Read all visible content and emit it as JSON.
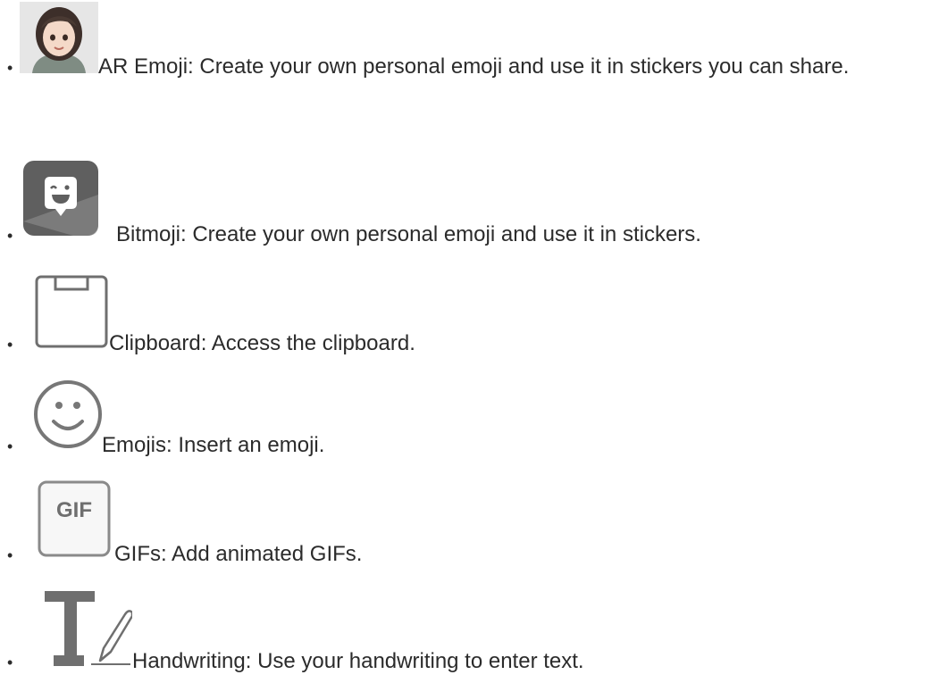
{
  "bullet": "•",
  "features": [
    {
      "icon": "ar-emoji-avatar-icon",
      "text": "AR Emoji: Create your own personal emoji and use it in stickers you can share."
    },
    {
      "icon": "bitmoji-icon",
      "text": "Bitmoji: Create your own personal emoji and use it in stickers."
    },
    {
      "icon": "clipboard-icon",
      "text": "Clipboard: Access the clipboard."
    },
    {
      "icon": "emoji-smiley-icon",
      "text": "Emojis: Insert an emoji."
    },
    {
      "icon": "gif-icon",
      "text": "GIFs: Add animated GIFs.",
      "icon_text": "GIF"
    },
    {
      "icon": "handwriting-icon",
      "text": "Handwriting: Use your handwriting to enter text."
    }
  ],
  "colors": {
    "text": "#2b2b2b",
    "icon_gray": "#707070",
    "icon_light": "#8a8a8a"
  }
}
